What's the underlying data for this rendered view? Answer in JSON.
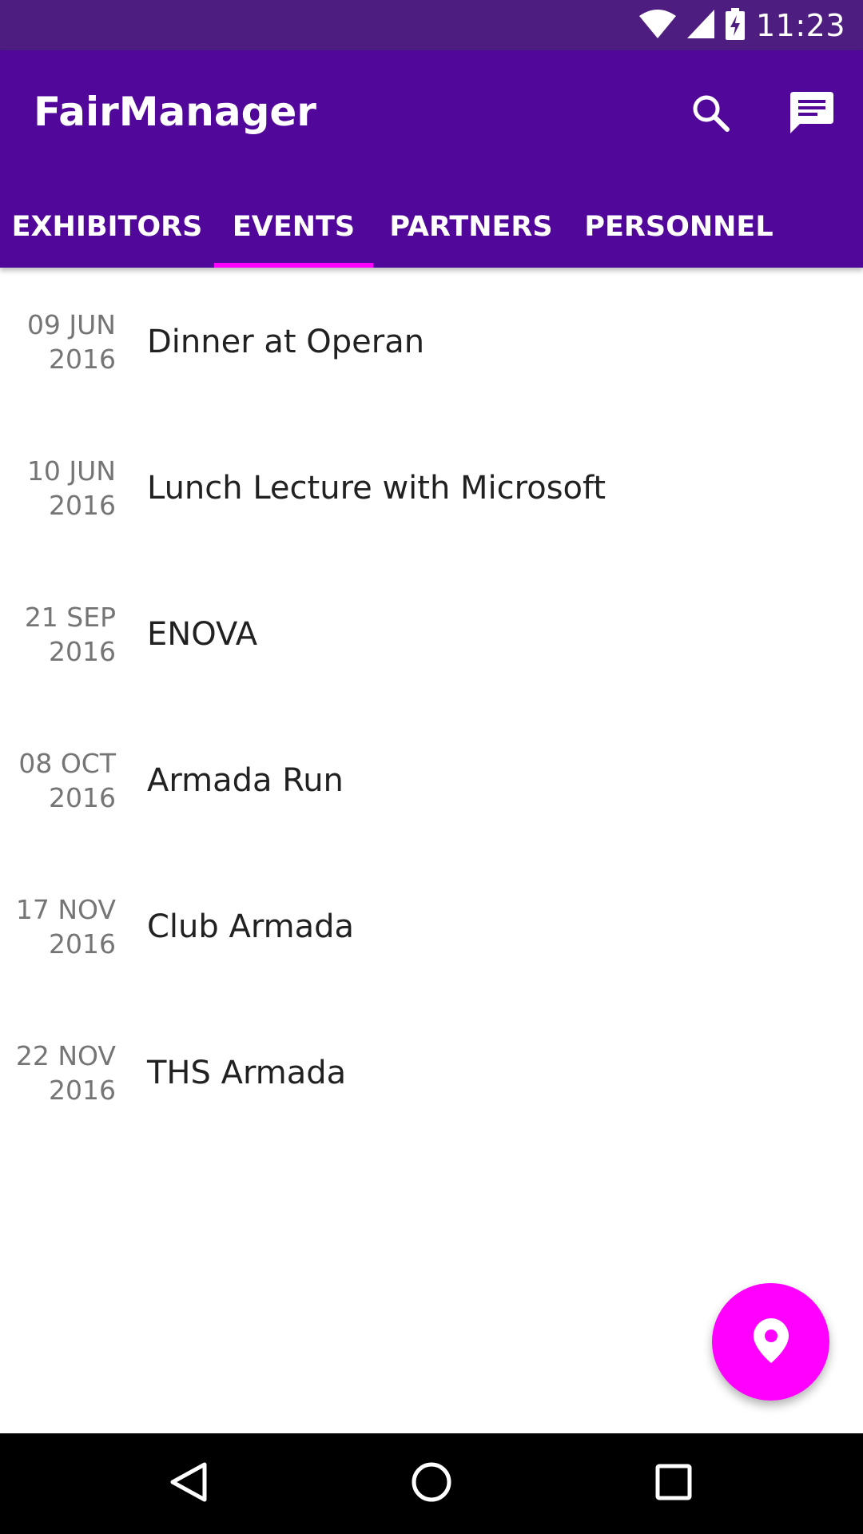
{
  "status_bar": {
    "time": "11:23",
    "icons": [
      "wifi-icon",
      "signal-icon",
      "battery-charging-icon"
    ]
  },
  "app_bar": {
    "title": "FairManager",
    "actions": [
      "search-icon",
      "chat-icon"
    ]
  },
  "tabs": [
    {
      "label": "EXHIBITORS",
      "selected": false
    },
    {
      "label": "EVENTS",
      "selected": true
    },
    {
      "label": "PARTNERS",
      "selected": false
    },
    {
      "label": "PERSONNEL",
      "selected": false
    }
  ],
  "events": [
    {
      "day_month": "09 JUN",
      "year": "2016",
      "title": "Dinner at Operan"
    },
    {
      "day_month": "10 JUN",
      "year": "2016",
      "title": "Lunch Lecture with Microsoft"
    },
    {
      "day_month": "21 SEP",
      "year": "2016",
      "title": "ENOVA"
    },
    {
      "day_month": "08 OCT",
      "year": "2016",
      "title": "Armada Run"
    },
    {
      "day_month": "17 NOV",
      "year": "2016",
      "title": "Club Armada"
    },
    {
      "day_month": "22 NOV",
      "year": "2016",
      "title": "THS Armada"
    }
  ],
  "fab": {
    "icon": "map-pin-icon"
  },
  "nav_bar": {
    "icons": [
      "back-icon",
      "home-icon",
      "recents-icon"
    ]
  },
  "colors": {
    "status_bar": "#4d1e7f",
    "app_bar": "#52079b",
    "accent": "#ff00ff",
    "date_text": "#757575",
    "title_text": "#212121"
  }
}
